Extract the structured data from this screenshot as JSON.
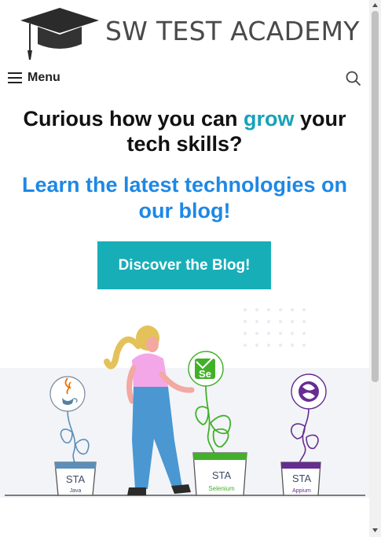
{
  "site": {
    "brand": "SW TEST ACADEMY",
    "logo_icon": "graduation-cap-icon"
  },
  "nav": {
    "menu_label": "Menu",
    "menu_icon": "hamburger-icon",
    "search_icon": "search-icon"
  },
  "hero": {
    "headline_part1": "Curious how you can ",
    "headline_accent": "grow",
    "headline_part2": " your tech skills?",
    "subline": "Learn the latest technologies on our blog!",
    "cta_label": "Discover the Blog!"
  },
  "illustration": {
    "pots": [
      {
        "logo": "java-icon",
        "label": "STA",
        "sublabel": "Java",
        "color": "#5b8fb9"
      },
      {
        "logo": "selenium-icon",
        "logo_text": "Se",
        "label": "STA",
        "sublabel": "Selenium",
        "color": "#43b02a"
      },
      {
        "logo": "appium-icon",
        "label": "STA",
        "sublabel": "Appium",
        "color": "#662d91"
      }
    ]
  },
  "colors": {
    "accent": "#17a2b8",
    "link_blue": "#1e88e5",
    "cta_bg": "#17aeb8"
  }
}
